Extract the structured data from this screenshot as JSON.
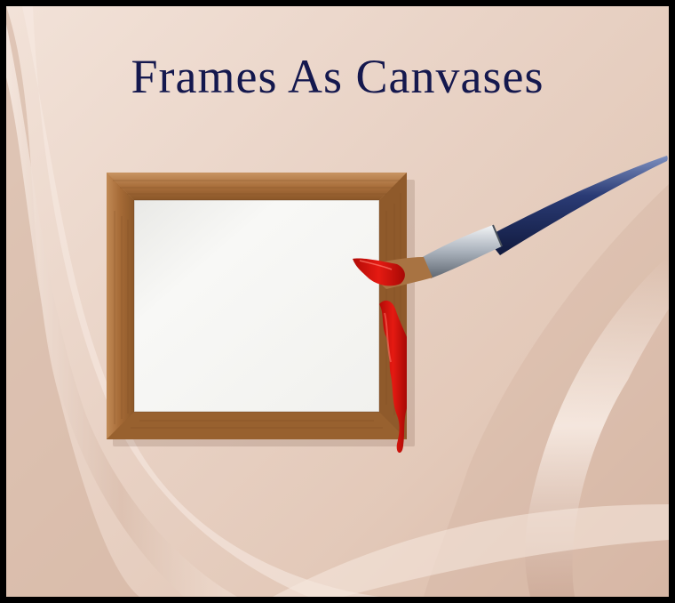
{
  "title": "Frames As Canvases",
  "colors": {
    "title": "#14184e",
    "fabric": "#e9d3c6",
    "frame_wood": "#b27a45",
    "canvas": "#f3f3f1",
    "paint": "#d8120c",
    "brush_handle": "#1f2f66",
    "ferrule": "#c9cfd6"
  },
  "icons": [
    "paintbrush-icon"
  ]
}
